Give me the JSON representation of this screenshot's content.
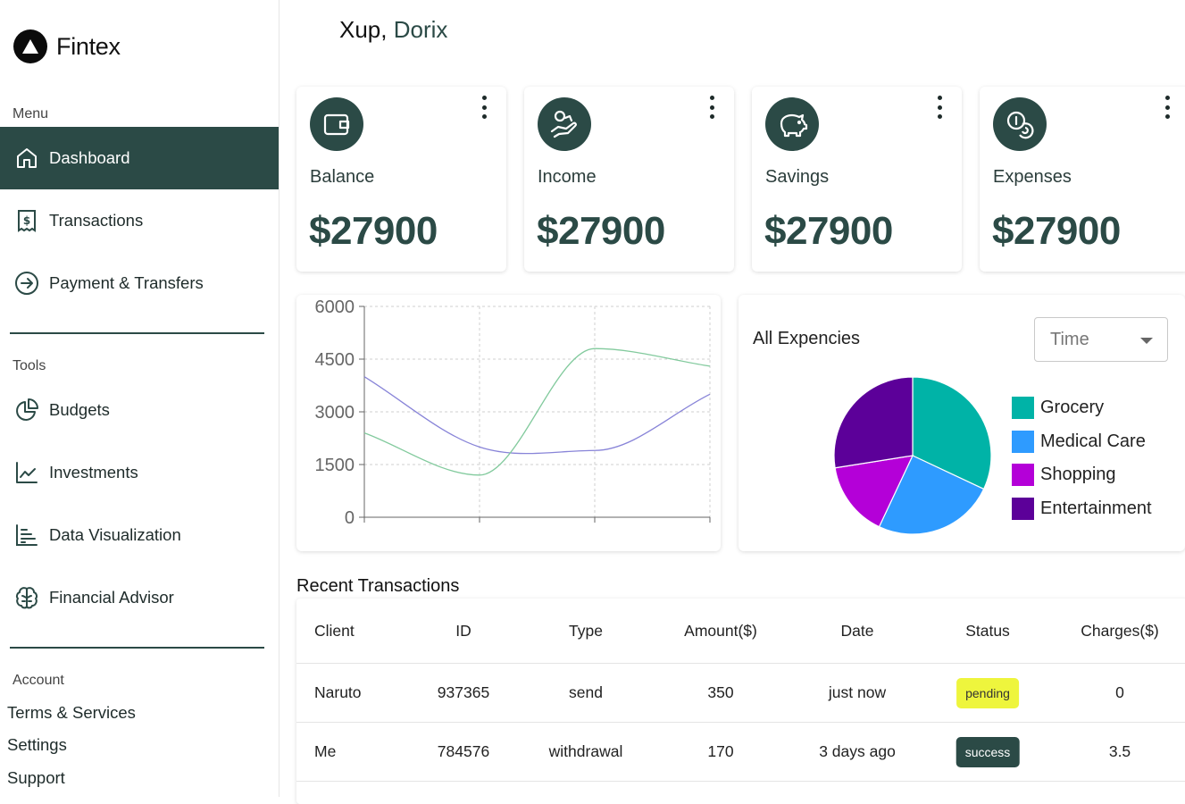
{
  "brand": {
    "name": "Fintex"
  },
  "sidebar": {
    "menu_label": "Menu",
    "menu_items": [
      {
        "label": "Dashboard",
        "icon": "home-icon",
        "active": true
      },
      {
        "label": "Transactions",
        "icon": "receipt-icon"
      },
      {
        "label": "Payment & Transfers",
        "icon": "arrow-circle-icon"
      }
    ],
    "tools_label": "Tools",
    "tools_items": [
      {
        "label": "Budgets",
        "icon": "pie-icon"
      },
      {
        "label": "Investments",
        "icon": "trend-icon"
      },
      {
        "label": "Data Visualization",
        "icon": "bar-chart-icon"
      },
      {
        "label": "Financial Advisor",
        "icon": "brain-icon"
      }
    ],
    "account_label": "Account",
    "account_links": [
      "Terms & Services",
      "Settings",
      "Support"
    ]
  },
  "greeting": {
    "prefix": "Xup, ",
    "name": "Dorix"
  },
  "cards": [
    {
      "label": "Balance",
      "value": "$27900",
      "icon": "wallet-icon"
    },
    {
      "label": "Income",
      "value": "$27900",
      "icon": "hand-coin-icon"
    },
    {
      "label": "Savings",
      "value": "$27900",
      "icon": "piggy-bank-icon"
    },
    {
      "label": "Expenses",
      "value": "$27900",
      "icon": "coins-icon"
    }
  ],
  "chart_data": [
    {
      "type": "line",
      "x": [
        0,
        1,
        2,
        3
      ],
      "ylim": [
        0,
        6000
      ],
      "yticks": [
        0,
        1500,
        3000,
        4500,
        6000
      ],
      "ytick_labels": [
        "0",
        "1500",
        "3000",
        "4500",
        "6000"
      ],
      "grid": true,
      "series": [
        {
          "color": "#8884d8",
          "values": [
            4000,
            2000,
            1900,
            3500
          ]
        },
        {
          "color": "#82ca9d",
          "values": [
            2400,
            1200,
            4800,
            4300
          ]
        }
      ]
    },
    {
      "type": "pie",
      "title": "All Expencies",
      "labels": [
        "Grocery",
        "Medical Care",
        "Shopping",
        "Entertainment"
      ],
      "values": [
        32,
        25,
        15.5,
        27.5
      ],
      "colors": [
        "#00b3a7",
        "#2e9bff",
        "#b400d8",
        "#5c0099"
      ]
    }
  ],
  "filter": {
    "value": "Time"
  },
  "transactions": {
    "title": "Recent Transactions",
    "columns": [
      "Client",
      "ID",
      "Type",
      "Amount($)",
      "Date",
      "Status",
      "Charges($)"
    ],
    "rows": [
      {
        "client": "Naruto",
        "id": "937365",
        "type": "send",
        "amount": "350",
        "date": "just now",
        "status": "pending",
        "charges": "0"
      },
      {
        "client": "Me",
        "id": "784576",
        "type": "withdrawal",
        "amount": "170",
        "date": "3 days ago",
        "status": "success",
        "charges": "3.5"
      }
    ]
  }
}
